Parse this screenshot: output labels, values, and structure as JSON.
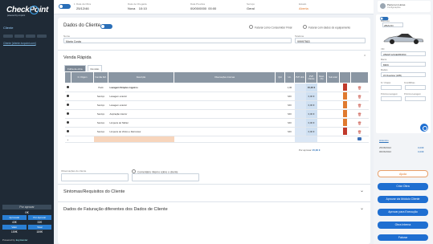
{
  "sidebar": {
    "logo": "CheckPoint",
    "logo_tagline": "powered by ivnpoint",
    "client_label": "Cliente",
    "client_link": "Cliente [cliente.ivnpoint.com]",
    "payment": {
      "title": "Por aprovar",
      "total": "0€",
      "approved_label": "Aprovado",
      "approved_value": "43€",
      "to_approve_label": "Por Aprovar",
      "to_approve_value": "33€",
      "net_label": "Valor",
      "net_value": "159€",
      "gross_label": "Total",
      "gross_value": "159€"
    },
    "powered_by": "Powered by",
    "powered_brand": "keymaster"
  },
  "topbar": {
    "doc_number": "1",
    "doc_date_label": "Data da Obra",
    "doc_date": "25/12/46",
    "origin_label": "Data de Chegada",
    "origin": "Nova",
    "origin_time": "10:10",
    "date_label": "Data Prevista",
    "date": "00/00/0000",
    "date_time": "00:00",
    "sector_label": "Serviço",
    "sector": "Geral",
    "status_label": "Estado",
    "status": "Aberta"
  },
  "client": {
    "title": "Dados do Cliente",
    "radio_final": "Faturar como Consumidor Final",
    "radio_equip": "Faturar com dados do equipamento",
    "name_label": "Nome",
    "name_value": "Maria Costa",
    "phone_label": "Telefone",
    "phone_value": "99997563"
  },
  "sale": {
    "title": "Venda Rápida",
    "tabs": [
      "Folha de obra",
      "Revisão"
    ],
    "headers": [
      "",
      "N. Origem",
      "Família Ref.",
      "Descrição",
      "Observações Internas",
      "Qtd",
      "Un.",
      "PVP Unit.",
      "PVP Cliente",
      "Desc. (%)",
      "Sub-total",
      "",
      ""
    ],
    "rows": [
      {
        "family": "Pack",
        "desc": "Lavagem Simples Ligeiros",
        "unit": "1,00",
        "price": "15,00 €",
        "swatch": "#c0392b"
      },
      {
        "family": "Serviço",
        "desc": "Lavagem exterior",
        "unit": "MO",
        "price": "0,00 €",
        "swatch": "#e07a2f"
      },
      {
        "family": "Serviço",
        "desc": "Lavagem exterior",
        "unit": "MO",
        "price": "0,00 €",
        "swatch": "#e07a2f"
      },
      {
        "family": "Serviço",
        "desc": "Aspiração interior",
        "unit": "MO",
        "price": "0,00 €",
        "swatch": "#e07a2f"
      },
      {
        "family": "Serviço",
        "desc": "Limpeza de Tablier",
        "unit": "MO",
        "price": "0,00 €",
        "swatch": "#e07a2f"
      },
      {
        "family": "Serviço",
        "desc": "Limpeza de Vidros e Retrovisor",
        "unit": "MO",
        "price": "0,00 €",
        "swatch": "#c0392b"
      }
    ],
    "total_label": "Por aprovar",
    "total_value": "15,00 €"
  },
  "observations": {
    "client_label": "Observações do cliente",
    "internal_label": "Comentário interno sobre o cliente"
  },
  "sections": {
    "symptoms": "Sintomas/Requisitos do Cliente",
    "billing": "Dados de Faturação diferentes dos Dados de Cliente"
  },
  "user": {
    "name": "Parcel em Horas",
    "subtitle": "Configurações"
  },
  "vehicle": {
    "plate_label": "Matrícula",
    "plate": "28MLXD",
    "vin_label": "VIN",
    "vin": "WBA871234E0856650",
    "brand_label": "Marca",
    "brand": "BMW",
    "model_label": "Modelo",
    "model": "Z4 Roadster (E85)",
    "km_label": "N.º Chassi",
    "km_value": "Kms/Milhas",
    "fuel_label": "Próxima Lavagem",
    "fuel_value": "Próxima Lavagem"
  },
  "history": {
    "link": "Histórico",
    "entries": [
      {
        "date": "25/08/2022",
        "amount": "0,00€"
      },
      {
        "date": "06/06/2022",
        "amount": "0,00€"
      }
    ]
  },
  "actions": {
    "help": "Ajuda",
    "create": "Criar Obra",
    "approve_module": "Aprovar via Módulo Cliente",
    "approve_exec": "Aprovar para Execução",
    "internal": "Obra Interna",
    "invoice": "Faturar"
  }
}
